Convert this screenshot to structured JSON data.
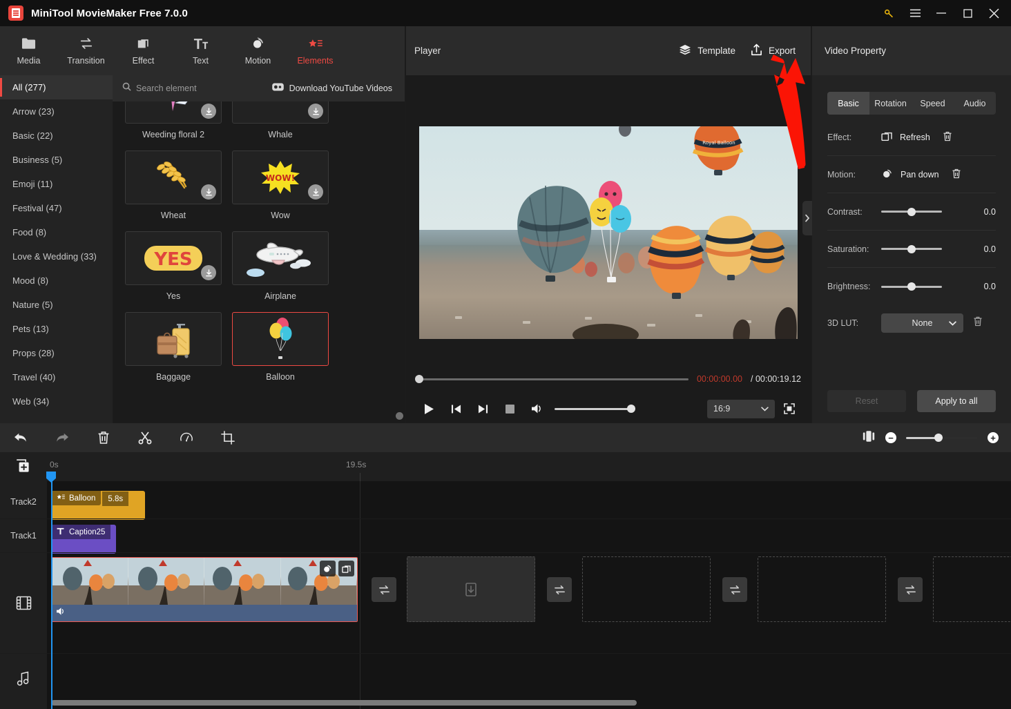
{
  "titlebar": {
    "app_name": "MiniTool MovieMaker Free 7.0.0",
    "logo_icon": "app-logo-icon",
    "buttons": [
      {
        "name": "license-key",
        "icon": "key-icon",
        "glyph": "⚷"
      },
      {
        "name": "menu",
        "icon": "hamburger-menu-icon",
        "glyph": "☰"
      },
      {
        "name": "minimize",
        "icon": "minimize-icon",
        "glyph": "─"
      },
      {
        "name": "maximize",
        "icon": "maximize-icon",
        "glyph": "□"
      },
      {
        "name": "close",
        "icon": "close-icon",
        "glyph": "✕"
      }
    ]
  },
  "topnav": {
    "items": [
      {
        "label": "Media",
        "icon": "folder-icon",
        "active": false
      },
      {
        "label": "Transition",
        "icon": "transition-arrows-icon",
        "active": false
      },
      {
        "label": "Effect",
        "icon": "layers-square-icon",
        "active": false
      },
      {
        "label": "Text",
        "icon": "text-tt-icon",
        "active": false
      },
      {
        "label": "Motion",
        "icon": "motion-circle-icon",
        "active": false
      },
      {
        "label": "Elements",
        "icon": "elements-star-icon",
        "active": true
      }
    ],
    "active_color": "#ef4a43"
  },
  "categories": [
    {
      "label": "All (277)",
      "active": true
    },
    {
      "label": "Arrow (23)",
      "active": false
    },
    {
      "label": "Basic (22)",
      "active": false
    },
    {
      "label": "Business (5)",
      "active": false
    },
    {
      "label": "Emoji (11)",
      "active": false
    },
    {
      "label": "Festival (47)",
      "active": false
    },
    {
      "label": "Food (8)",
      "active": false
    },
    {
      "label": "Love & Wedding (33)",
      "active": false
    },
    {
      "label": "Mood (8)",
      "active": false
    },
    {
      "label": "Nature (5)",
      "active": false
    },
    {
      "label": "Pets (13)",
      "active": false
    },
    {
      "label": "Props (28)",
      "active": false
    },
    {
      "label": "Travel (40)",
      "active": false
    },
    {
      "label": "Web (34)",
      "active": false
    }
  ],
  "element_panel": {
    "search_placeholder": "Search element",
    "search_icon": "search-icon",
    "download_youtube_label": "Download YouTube Videos",
    "download_youtube_icon": "youtube-icon",
    "elements": [
      {
        "label": "Weeding floral 2",
        "downloadable": true,
        "selected": false,
        "art": "floral"
      },
      {
        "label": "Whale",
        "downloadable": true,
        "selected": false,
        "art": "whale"
      },
      {
        "label": "Wheat",
        "downloadable": true,
        "selected": false,
        "art": "wheat"
      },
      {
        "label": "Wow",
        "downloadable": true,
        "selected": false,
        "art": "wow"
      },
      {
        "label": "Yes",
        "downloadable": true,
        "selected": false,
        "art": "yes"
      },
      {
        "label": "Airplane",
        "downloadable": false,
        "selected": false,
        "art": "airplane"
      },
      {
        "label": "Baggage",
        "downloadable": false,
        "selected": false,
        "art": "baggage"
      },
      {
        "label": "Balloon",
        "downloadable": false,
        "selected": true,
        "art": "balloon"
      }
    ]
  },
  "player": {
    "title": "Player",
    "template_label": "Template",
    "template_icon": "layers-stack-icon",
    "export_label": "Export",
    "export_icon": "export-upload-icon",
    "current_time": "00:00:00.00",
    "total_time": "/ 00:00:19.12",
    "current_time_color": "#c0392b",
    "seek_progress_pct": 0,
    "volume_pct": 100,
    "aspect_ratio": "16:9",
    "controls": [
      {
        "name": "play-button",
        "icon": "play-icon"
      },
      {
        "name": "previous-frame-button",
        "icon": "skip-previous-icon"
      },
      {
        "name": "next-frame-button",
        "icon": "skip-next-icon"
      },
      {
        "name": "stop-button",
        "icon": "stop-square-icon"
      },
      {
        "name": "volume-button",
        "icon": "speaker-icon"
      }
    ],
    "fullscreen_icon": "fullscreen-icon"
  },
  "property_panel": {
    "title": "Video Property",
    "tabs": [
      {
        "label": "Basic",
        "active": true
      },
      {
        "label": "Rotation",
        "active": false
      },
      {
        "label": "Speed",
        "active": false
      },
      {
        "label": "Audio",
        "active": false
      }
    ],
    "effect_label": "Effect:",
    "effect_value": "Refresh",
    "effect_icon": "effect-layers-icon",
    "motion_label": "Motion:",
    "motion_value": "Pan down",
    "motion_icon": "motion-circle-icon",
    "delete_icon": "trash-icon",
    "sliders": [
      {
        "label": "Contrast:",
        "value": "0.0",
        "pct": 50
      },
      {
        "label": "Saturation:",
        "value": "0.0",
        "pct": 50
      },
      {
        "label": "Brightness:",
        "value": "0.0",
        "pct": 50
      }
    ],
    "lut_label": "3D LUT:",
    "lut_value": "None",
    "lut_chevron_icon": "chevron-down-icon",
    "reset_label": "Reset",
    "reset_disabled": true,
    "apply_label": "Apply to all",
    "collapse_icon": "chevron-right-icon"
  },
  "timeline_toolbar": {
    "buttons": [
      {
        "name": "undo-button",
        "icon": "undo-arrow-icon",
        "dim": false
      },
      {
        "name": "redo-button",
        "icon": "redo-arrow-icon",
        "dim": true
      },
      {
        "name": "delete-button",
        "icon": "trash-icon",
        "dim": false
      },
      {
        "name": "split-button",
        "icon": "scissors-icon",
        "dim": false
      },
      {
        "name": "speed-button",
        "icon": "speedometer-icon",
        "dim": false
      },
      {
        "name": "crop-button",
        "icon": "crop-icon",
        "dim": false
      }
    ],
    "fit-icon": "fit-timeline-icon",
    "zoom_out_glyph": "−",
    "zoom_in_glyph": "+",
    "zoom_pct": 45
  },
  "timeline": {
    "add_media_icon": "add-media-icon",
    "ruler_start": "0s",
    "ruler_end": "19.5s",
    "tracks": [
      {
        "name": "Track2",
        "type": "element"
      },
      {
        "name": "Track1",
        "type": "text"
      }
    ],
    "element_clip": {
      "label": "Balloon",
      "duration": "5.8s",
      "icon": "elements-star-icon",
      "color": "#e0a424"
    },
    "text_clip": {
      "label": "Caption25",
      "icon": "text-t-icon",
      "color": "#6b4ec4"
    },
    "video_track_icon": "film-strip-icon",
    "audio_track_icon": "music-note-icon",
    "video_clip": {
      "mute_icon": "speaker-icon",
      "tools": [
        {
          "name": "motion-tool",
          "icon": "motion-circle-icon"
        },
        {
          "name": "effect-tool",
          "icon": "layers-square-icon"
        }
      ]
    },
    "transition_icon": "transition-arrows-icon",
    "empty_slot_icon": "download-box-icon",
    "transition_count": 4,
    "empty_slot_count": 4
  },
  "annotation": {
    "arrow_color": "#fb1405",
    "points_to": "Export"
  }
}
